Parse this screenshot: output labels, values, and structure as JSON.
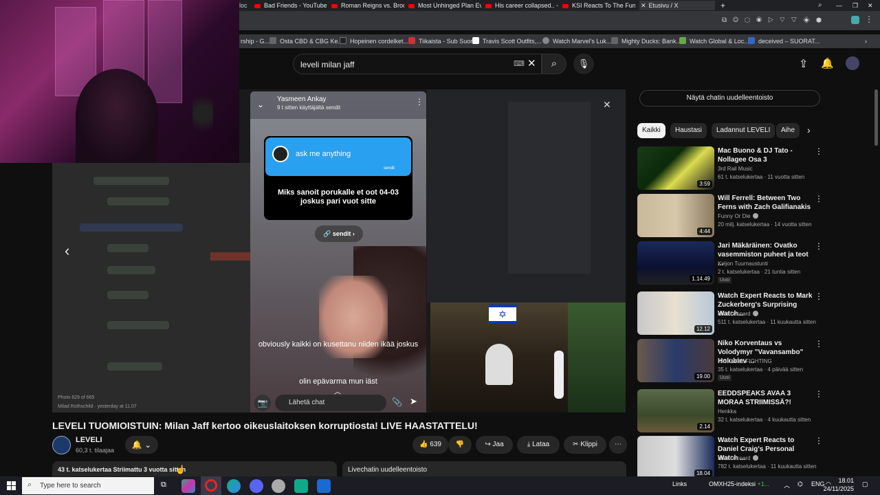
{
  "browser": {
    "tabs": [
      {
        "label": "Bad Friends - YouTube"
      },
      {
        "label": "Roman Reigns vs. Brock L"
      },
      {
        "label": "Most Unhinged Plan Ever"
      },
      {
        "label": "His career collapsed.. - Yo"
      },
      {
        "label": "KSI Reacts To The Funnies"
      },
      {
        "label": "Etusivu / X"
      }
    ],
    "bookmarks": [
      {
        "label": "Osta CBD & CBG Ke..."
      },
      {
        "label": "Hopeinen cordelket..."
      },
      {
        "label": "Tiikaista - Sub Suora"
      },
      {
        "label": "Travis Scott Outfits,..."
      },
      {
        "label": "Watch Marvel's Luk..."
      },
      {
        "label": "Mighty Ducks: Bank..."
      },
      {
        "label": "Watch Global & Loc..."
      },
      {
        "label": "deceived – SUORAT..."
      }
    ]
  },
  "header": {
    "search_value": "leveli milan jaff"
  },
  "player": {
    "story_user": "Yasmeen Ankay",
    "story_sub": "9 t sitten käyttäjältä sendit",
    "ama_label": "ask me anything",
    "ama_brand": "sendit",
    "ama_question": "Miks sanoit porukalle et oot 04-03 joskus pari vuot sitte",
    "sendit_pill": "sendit",
    "caption1": "obviously kaikki on kusettanu niiden ikää joskus",
    "caption2": "olin epävarma mun iäst",
    "chat_placeholder": "Lähetä chat",
    "photo_counter": "Photo 629 of 665",
    "photo_author": "Milad Rothschild · yesterday at 11.07"
  },
  "video": {
    "title": "LEVELI TUOMIOISTUIN: Milan Jaff kertoo oikeuslaitoksen korruptiosta! LIVE HAASTATTELU!",
    "channel": "LEVELI",
    "subs": "60,3 t. tilaajaa",
    "likes": "639",
    "share": "Jaa",
    "download": "Lataa",
    "clip": "Klippi",
    "desc": "43 t. katselukertaa  Striimattu 3 vuotta sitten",
    "livechat_replay": "Livechatin uudelleentoisto"
  },
  "sidebar": {
    "chat_replay_btn": "Näytä chatin uudelleentoisto",
    "chips": [
      "Kaikki",
      "Haustasi",
      "Ladannut LEVELI",
      "Aihe"
    ],
    "recs": [
      {
        "title": "Mac Buono & DJ Tato - Nollagee Osa 3",
        "channel": "3rd Rail Music",
        "meta": "61 t. katselukertaa · 11 vuotta sitten",
        "duration": "3:59",
        "badge": ""
      },
      {
        "title": "Will Ferrell: Between Two Ferns with Zach Galifianakis",
        "channel": "Funny Or Die",
        "meta": "20 milj. katselukertaa · 14 vuotta sitten",
        "duration": "4:44",
        "badge": ""
      },
      {
        "title": "Jari Mäkäräinen: Ovatko vasemmiston puheet ja teot ...",
        "channel": "Keijon Tuurnaustunti",
        "meta": "2 t. katselukertaa · 21 tuntia sitten",
        "duration": "1.14.49",
        "badge": "Uusi"
      },
      {
        "title": "Watch Expert Reacts to Mark Zuckerberg's Surprising Watch...",
        "channel": "Nico Leonard",
        "meta": "511 t. katselukertaa · 11 kuukautta sitten",
        "duration": "12.12",
        "badge": ""
      },
      {
        "title": "Niko Korventaus vs Volodymyr \"Vavansambo\" Holubiev ...",
        "channel": "ICE CAGE FIGHTING",
        "meta": "35 t. katselukertaa · 4 päivää sitten",
        "duration": "19.00",
        "badge": "Uusi"
      },
      {
        "title": "EEDDSPEAKS AVAA 3 MORAA STRIIMISSÄ?!",
        "channel": "Henkka",
        "meta": "32 t. katselukertaa · 4 kuukautta sitten",
        "duration": "2.14",
        "badge": ""
      },
      {
        "title": "Watch Expert Reacts to Daniel Craig's Personal Watch ...",
        "channel": "Nico Leonard",
        "meta": "782 t. katselukertaa · 11 kuukautta sitten",
        "duration": "18.04",
        "badge": ""
      }
    ]
  },
  "taskbar": {
    "search_placeholder": "Type here to search",
    "links": "Links",
    "stock": "OMXH25-indeksi",
    "stock_change": "+1...",
    "lang": "ENG",
    "time": "18.01",
    "date": "24/11/2025"
  }
}
